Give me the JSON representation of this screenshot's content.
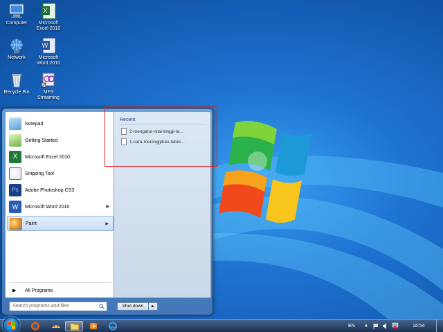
{
  "desktop": {
    "icons": [
      {
        "label_line1": "Computer",
        "label_line2": "",
        "icon": "computer-icon"
      },
      {
        "label_line1": "Microsoft",
        "label_line2": "Excel 2010",
        "icon": "excel-icon"
      },
      {
        "label_line1": "Network",
        "label_line2": "",
        "icon": "network-icon"
      },
      {
        "label_line1": "Microsoft",
        "label_line2": "Word 2010",
        "icon": "word-icon"
      },
      {
        "label_line1": "Recycle Bin",
        "label_line2": "",
        "icon": "recycle-bin-icon"
      },
      {
        "label_line1": "MP3",
        "label_line2": "Streaming",
        "icon": "mp3-streaming-icon"
      }
    ]
  },
  "start_menu": {
    "programs": [
      {
        "label": "Notepad",
        "icon": "notepad-icon",
        "has_arrow": false
      },
      {
        "label": "Getting Started",
        "icon": "getting-started-icon",
        "has_arrow": false
      },
      {
        "label": "Microsoft Excel 2010",
        "icon": "excel-icon",
        "has_arrow": false
      },
      {
        "label": "Snipping Tool",
        "icon": "snipping-tool-icon",
        "has_arrow": false
      },
      {
        "label": "Adobe Photoshop CS3",
        "icon": "photoshop-icon",
        "has_arrow": false
      },
      {
        "label": "Microsoft Word 2010",
        "icon": "word-icon",
        "has_arrow": true
      },
      {
        "label": "Paint",
        "icon": "paint-icon",
        "has_arrow": true,
        "selected": true
      }
    ],
    "all_programs": "All Programs",
    "search_placeholder": "Search programs and files",
    "shutdown_label": "Shut down",
    "recent": {
      "header": "Recent",
      "items": [
        "2-mengatur-nilai-tinggi-ta...",
        "1-cara-meninggikan-tabel-..."
      ]
    }
  },
  "taskbar": {
    "pinned": [
      "start-orb",
      "firefox-icon",
      "paint-icon",
      "explorer-icon",
      "media-player-icon",
      "internet-explorer-icon"
    ],
    "language": "EN",
    "clock": "16:54"
  },
  "colors": {
    "highlight_border": "#e0201e",
    "recent_header": "#1e3287"
  }
}
